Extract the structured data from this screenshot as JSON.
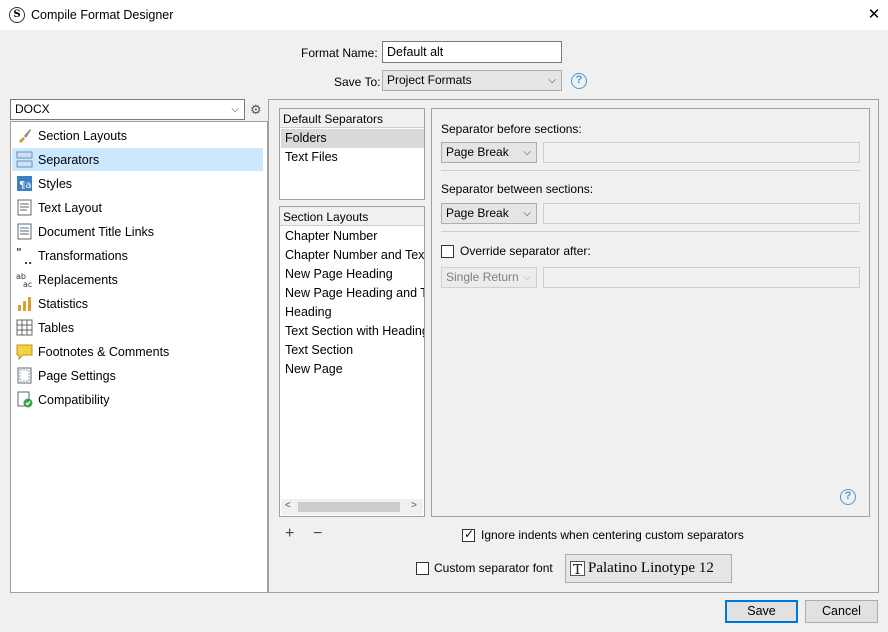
{
  "window": {
    "title": "Compile Format Designer"
  },
  "format": {
    "name_label": "Format Name:",
    "name_value": "Default alt",
    "save_label": "Save To:",
    "save_value": "Project Formats"
  },
  "sidebar": {
    "format_select": "DOCX",
    "items": [
      {
        "label": "Section Layouts",
        "icon": "brush-icon"
      },
      {
        "label": "Separators",
        "icon": "separators-icon"
      },
      {
        "label": "Styles",
        "icon": "styles-icon"
      },
      {
        "label": "Text Layout",
        "icon": "text-layout-icon"
      },
      {
        "label": "Document Title Links",
        "icon": "document-links-icon"
      },
      {
        "label": "Transformations",
        "icon": "quotes-icon"
      },
      {
        "label": "Replacements",
        "icon": "replace-icon"
      },
      {
        "label": "Statistics",
        "icon": "bar-chart-icon"
      },
      {
        "label": "Tables",
        "icon": "table-icon"
      },
      {
        "label": "Footnotes & Comments",
        "icon": "comment-icon"
      },
      {
        "label": "Page Settings",
        "icon": "page-icon"
      },
      {
        "label": "Compatibility",
        "icon": "compat-icon"
      }
    ],
    "selected_index": 1
  },
  "default_separators": {
    "header": "Default Separators",
    "items": [
      "Folders",
      "Text Files"
    ]
  },
  "section_layouts": {
    "header": "Section Layouts",
    "items": [
      "Chapter Number",
      "Chapter Number and Text",
      "New Page Heading",
      "New Page Heading and Text",
      "Heading",
      "Text Section with Heading",
      "Text Section",
      "New Page"
    ]
  },
  "separator_settings": {
    "before_label": "Separator before sections:",
    "before_value": "Page Break",
    "between_label": "Separator between sections:",
    "between_value": "Page Break",
    "override_label": "Override separator after:",
    "override_value": "Single Return"
  },
  "bottom": {
    "add_symbol": "+",
    "remove_symbol": "−",
    "ignore_indents_label": "Ignore indents when centering custom separators",
    "custom_font_label": "Custom separator font",
    "font_button_label": "Palatino Linotype 12"
  },
  "buttons": {
    "save": "Save",
    "cancel": "Cancel"
  },
  "colors": {
    "selection": "#cce8ff",
    "accent": "#0078d7",
    "help": "#4a9bd6"
  }
}
